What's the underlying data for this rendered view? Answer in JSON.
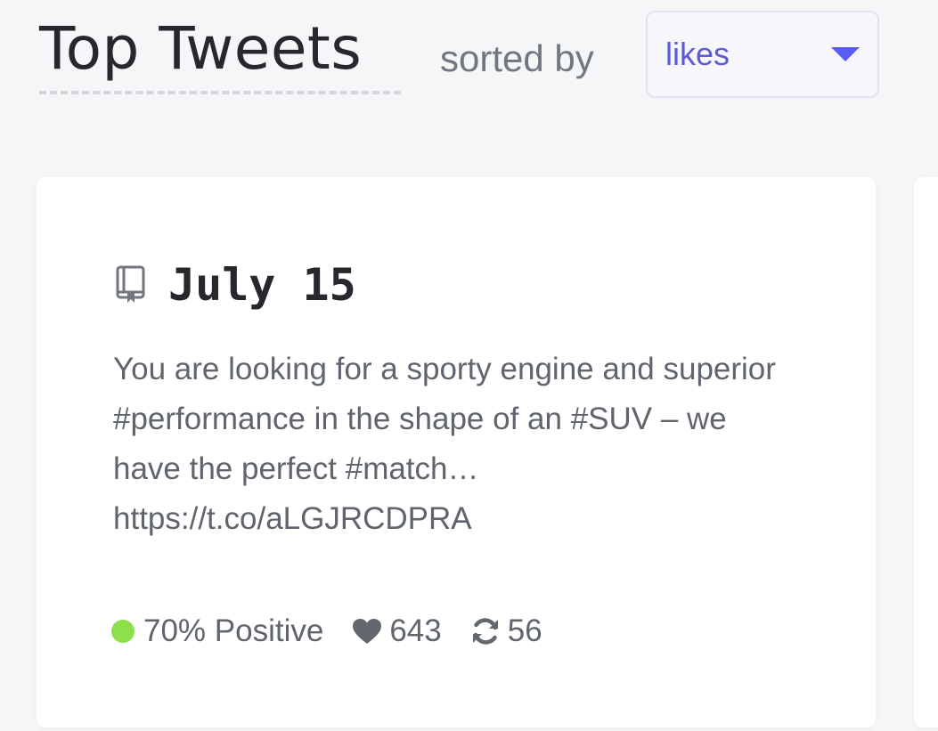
{
  "header": {
    "title": "Top Tweets",
    "sorted_by_label": "sorted by",
    "sort_select": {
      "value": "likes"
    }
  },
  "card": {
    "date": "July 15",
    "icon": "book-icon",
    "text": "You are looking for a sporty engine and superior #performance in the shape of an #SUV – we have the perfect #match… https://t.co/aLGJRCDPRA",
    "sentiment": {
      "label": "70% Positive",
      "color": "#8ee04a",
      "icon": "status-dot"
    },
    "likes": {
      "value": "643",
      "icon": "heart-icon"
    },
    "retweets": {
      "value": "56",
      "icon": "retweet-icon"
    }
  },
  "colors": {
    "accent": "#5b5bd6",
    "background": "#f5f6f8",
    "card": "#ffffff",
    "positive": "#8ee04a"
  }
}
